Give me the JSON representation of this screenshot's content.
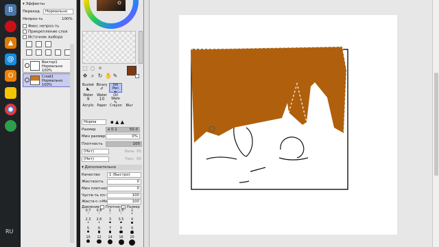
{
  "taskbar": {
    "icons": [
      {
        "name": "vk-icon",
        "glyph": "В",
        "color": "#4a76a8"
      },
      {
        "name": "opera-icon",
        "glyph": "O",
        "color": "#cc0f16"
      },
      {
        "name": "triangle-app-icon",
        "glyph": "▲",
        "color": "#e07b00"
      },
      {
        "name": "mail-icon",
        "glyph": "@",
        "color": "#168de2"
      },
      {
        "name": "ok-icon",
        "glyph": "О",
        "color": "#ee8208"
      },
      {
        "name": "chrome-icon",
        "glyph": "●",
        "color": "#4caf50"
      },
      {
        "name": "game-icon",
        "glyph": "◉",
        "color": "#2e9e4a"
      }
    ],
    "lang": "RU"
  },
  "left_panel": {
    "effects_header": "Эффекты",
    "mode_label": "Переход",
    "mode_value": "Нормально",
    "opacity_label": "Непроз-ть",
    "opacity_value": "100%",
    "checkbox_protect": "Фикс непроз-ть",
    "checkbox_clip": "Прикрепление слоя",
    "checkbox_source": "Источник выбора",
    "layers": [
      {
        "name": "Вектор1",
        "mode": "Нормально",
        "opacity": "100%",
        "selected": false
      },
      {
        "name": "Слой1",
        "mode": "Нормально",
        "opacity": "100%",
        "selected": true
      }
    ]
  },
  "tool_panel": {
    "current_color": "#7b3a12",
    "brushes": [
      {
        "label": "Bucket",
        "size": "",
        "active": false
      },
      {
        "label": "Binary",
        "size": "",
        "active": false
      },
      {
        "label": "Ink Pen",
        "size": "",
        "active": true
      },
      {
        "label": "Water",
        "size": "9",
        "active": false
      },
      {
        "label": "Water",
        "size": "10",
        "active": false
      },
      {
        "label": "Oil Wate",
        "size": "",
        "active": false
      },
      {
        "label": "Acrylic",
        "size": "",
        "active": false
      },
      {
        "label": "Paper",
        "size": "",
        "active": false
      },
      {
        "label": "Crayon",
        "size": "",
        "active": false
      },
      {
        "label": "Blur",
        "size": "",
        "active": false
      }
    ],
    "blend_mode": "Норма",
    "size_label": "Размер",
    "size_mult": "x 0.1",
    "size_value": "50.0",
    "min_size_label": "Мин размер",
    "min_size_value": "0%",
    "density_label": "Плотность",
    "density_value": "100",
    "paper_label": "(Нет)",
    "paper_right": "Вель",
    "paper_right_value": "95",
    "texture_label": "(Нет)",
    "texture_right": "Текс",
    "texture_right_value": "95",
    "advanced_header": "Дополнительно",
    "quality_label": "Качество",
    "quality_value": "1 (Быстро)",
    "hardness_label": "Жесткость",
    "hardness_value": "0",
    "min_density_label": "Мин плотность",
    "min_density_value": "0",
    "sensitivity_label": "Чуств-ть пп-ти",
    "sensitivity_value": "100",
    "hardness2_label": "Жестк<->Мягк",
    "hardness2_value": "100",
    "pressure_label": "Давление",
    "pressure_density": "Плотность",
    "pressure_size": "Размер",
    "sizes": [
      "0.7",
      "0.8",
      "1",
      "1.5",
      "2",
      "2.3",
      "2.6",
      "3",
      "3.5",
      "4",
      "5",
      "6",
      "7",
      "8",
      "9",
      "10",
      "12",
      "14",
      "16",
      "20"
    ]
  }
}
